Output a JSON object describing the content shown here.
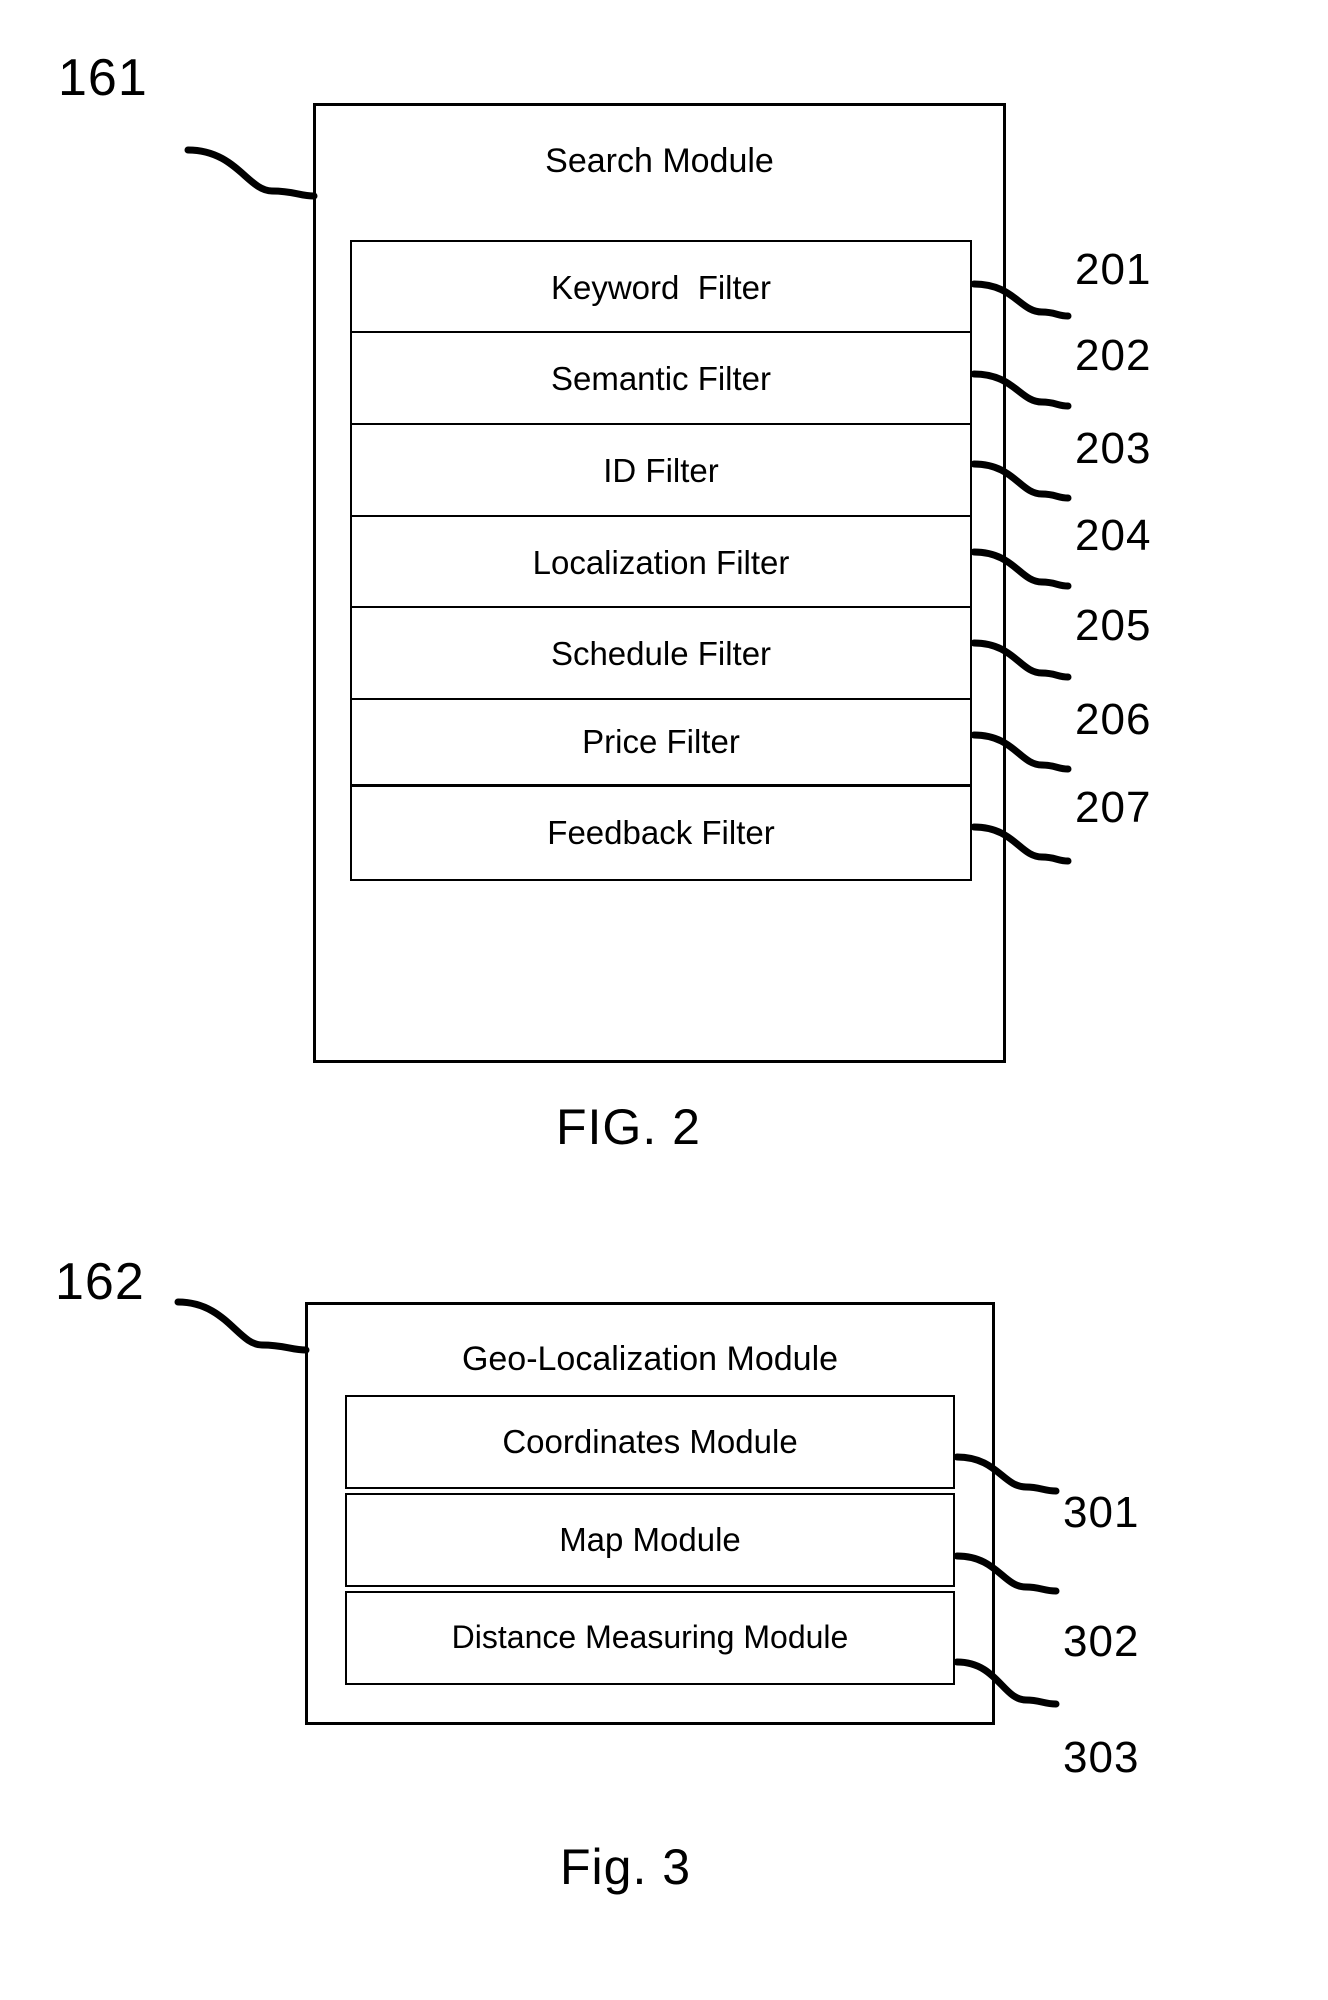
{
  "document": {
    "type": "patent-drawing-sheet",
    "background_color": "#ffffff",
    "line_color": "#000000"
  },
  "figure2": {
    "caption": "FIG. 2",
    "module_ref": "161",
    "title": "Search Module",
    "filters": [
      {
        "label": "Keyword  Filter",
        "ref": "201"
      },
      {
        "label": "Semantic Filter",
        "ref": "202"
      },
      {
        "label": "ID Filter",
        "ref": "203"
      },
      {
        "label": "Localization Filter",
        "ref": "204"
      },
      {
        "label": "Schedule Filter",
        "ref": "205"
      },
      {
        "label": "Price Filter",
        "ref": "206"
      },
      {
        "label": "Feedback Filter",
        "ref": "207"
      }
    ]
  },
  "figure3": {
    "caption": "Fig. 3",
    "module_ref": "162",
    "title": "Geo-Localization Module",
    "submodules": [
      {
        "label": "Coordinates Module",
        "ref": "301"
      },
      {
        "label": "Map Module",
        "ref": "302"
      },
      {
        "label": "Distance Measuring Module",
        "ref": "303"
      }
    ]
  }
}
